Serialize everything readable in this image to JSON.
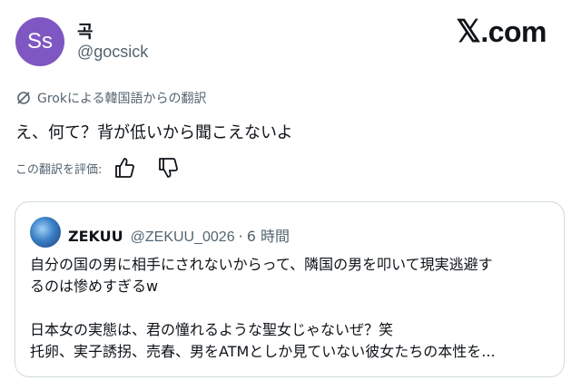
{
  "author": {
    "avatar_initials": "Ss",
    "avatar_color": "#7e57c2",
    "display_name": "곡",
    "handle": "@gocsick"
  },
  "brand": {
    "logo": "𝕏",
    "suffix": ".com"
  },
  "translation": {
    "label": "Grokによる韓国語からの翻訳",
    "icon": "grok-icon"
  },
  "tweet": {
    "text": "え、何て？背が低いから聞こえないよ"
  },
  "rating": {
    "label": "この翻訳を評価:",
    "thumbs_up_icon": "thumbs-up-icon",
    "thumbs_down_icon": "thumbs-down-icon"
  },
  "quote": {
    "name": "ZEKUU",
    "handle": "@ZEKUU_0026",
    "separator": "·",
    "time": "6 時間",
    "lines": [
      "自分の国の男に相手にされないからって、隣国の男を叩いて現実逃避す",
      "るのは惨めすぎるw",
      "日本女の実態は、君の憧れるような聖女じゃないぜ？笑",
      "托卵、実子誘拐、売春、男をATMとしか見ていない彼女たちの本性を..."
    ]
  },
  "colors": {
    "text": "#0f1419",
    "secondary": "#536471",
    "border": "#cfd9de"
  }
}
